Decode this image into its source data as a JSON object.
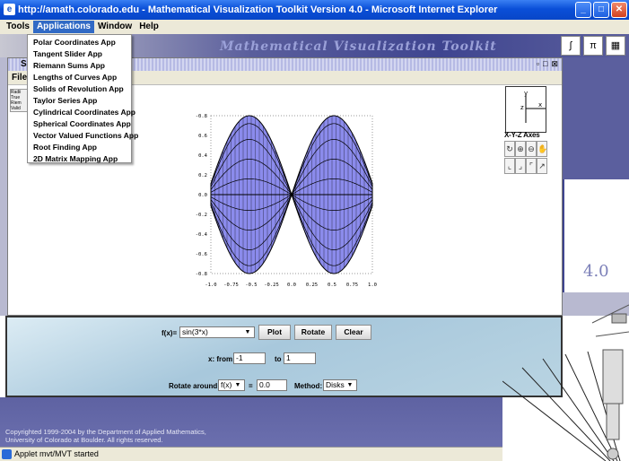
{
  "window": {
    "title": "http://amath.colorado.edu - Mathematical Visualization Toolkit Version 4.0 - Microsoft Internet Explorer",
    "buttons": [
      "_",
      "□",
      "✕"
    ]
  },
  "menubar": {
    "items": [
      "Tools",
      "Applications",
      "Window",
      "Help"
    ],
    "active": "Applications"
  },
  "toolkit": {
    "title": "Mathematical Visualization Toolkit",
    "version": "4.0"
  },
  "applications_menu": [
    "Polar Coordinates App",
    "Tangent Slider App",
    "Riemann Sums App",
    "Lengths of Curves App",
    "Solids of Revolution App",
    "Taylor Series App",
    "Cylindrical Coordinates App",
    "Spherical Coordinates App",
    "Vector Valued Functions App",
    "Root Finding App",
    "2D Matrix Mapping App"
  ],
  "inner_window": {
    "title": "S",
    "menu": "File",
    "side_tabs": [
      "Radii",
      "True",
      "Riem",
      "Valid"
    ]
  },
  "plot": {
    "function": "sin(3*x)",
    "x_ticks": [
      "-1.0",
      "-0.75",
      "-0.5",
      "-0.25",
      "0.0",
      "0.25",
      "0.5",
      "0.75",
      "1.0"
    ],
    "y_ticks": [
      "-0.8",
      "0.6",
      "0.4",
      "0.2",
      "0.0",
      "-0.2",
      "-0.4",
      "-0.6",
      "-0.8"
    ],
    "fill_color": "#6464e6",
    "stroke_color": "#000000"
  },
  "axes_widget": {
    "label": "X-Y-Z Axes",
    "y": "y",
    "z": "z",
    "x": "x"
  },
  "controls": {
    "function_label": "f(x)=",
    "function_value": "sin(3*x)",
    "plot_button": "Plot",
    "rotate_button": "Rotate",
    "clear_button": "Clear",
    "x_from_label": "x: from",
    "x_from_value": "-1",
    "to_label": "to",
    "x_to_value": "1",
    "rotate_around_label": "Rotate around:",
    "rotate_around_value": "f(x)",
    "equals_label": "=",
    "rotate_value": "0.0",
    "method_label": "Method:",
    "method_value": "Disks"
  },
  "footer": {
    "line1": "Copyrighted 1999-2004 by the Department of Applied Mathematics,",
    "line2": "University of Colorado at Boulder.  All rights reserved."
  },
  "status": {
    "text": "Applet mvt/MVT started"
  }
}
